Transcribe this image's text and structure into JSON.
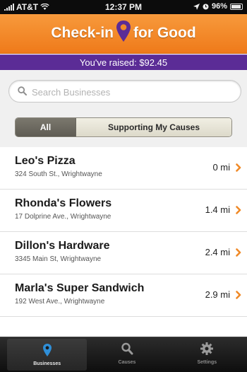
{
  "status_bar": {
    "carrier": "AT&T",
    "time": "12:37 PM",
    "battery": "96%"
  },
  "header": {
    "logo_left": "Check-in",
    "logo_right": "for Good"
  },
  "raised": {
    "text": "You've raised: $92.45"
  },
  "search": {
    "placeholder": "Search Businesses",
    "icon": "search-icon"
  },
  "filter": {
    "all_label": "All",
    "causes_label": "Supporting My Causes",
    "selected": "All"
  },
  "businesses": [
    {
      "name": "Leo's Pizza",
      "address": "324 South St., Wrightwayne",
      "distance": "0 mi"
    },
    {
      "name": "Rhonda's Flowers",
      "address": "17 Dolprine Ave., Wrightwayne",
      "distance": "1.4 mi"
    },
    {
      "name": "Dillon's Hardware",
      "address": "3345 Main St, Wrightwayne",
      "distance": "2.4 mi"
    },
    {
      "name": "Marla's Super Sandwich",
      "address": "192 West Ave., Wrightwayne",
      "distance": "2.9 mi"
    }
  ],
  "tabs": [
    {
      "label": "Businesses",
      "icon": "map-pin-icon",
      "active": true
    },
    {
      "label": "Causes",
      "icon": "search-icon",
      "active": false
    },
    {
      "label": "Settings",
      "icon": "gear-icon",
      "active": false
    }
  ],
  "colors": {
    "accent_orange": "#f08a28",
    "accent_purple": "#5b2c96",
    "pin_blue": "#2f8fd8"
  }
}
